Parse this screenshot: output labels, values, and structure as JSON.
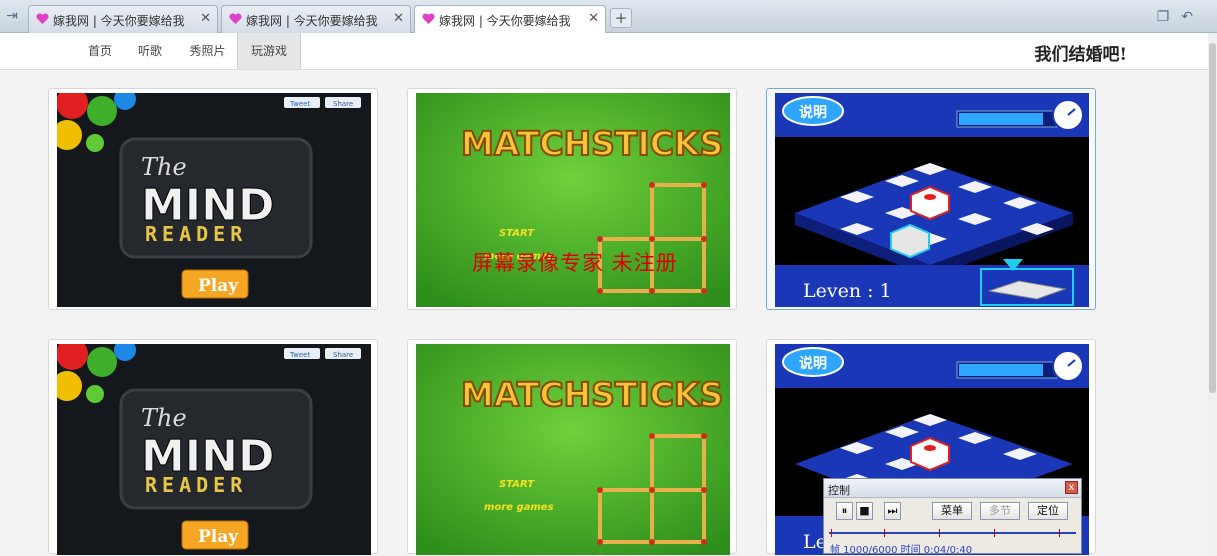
{
  "browser": {
    "tabs": [
      {
        "title": "嫁我网 | 今天你要嫁给我",
        "active": false
      },
      {
        "title": "嫁我网 | 今天你要嫁给我",
        "active": false
      },
      {
        "title": "嫁我网 | 今天你要嫁给我",
        "active": true
      }
    ],
    "newtab_label": "+",
    "close_label": "✕"
  },
  "nav": {
    "items": [
      "首页",
      "听歌",
      "秀照片",
      "玩游戏"
    ],
    "active_index": 3,
    "slogan": "我们结婚吧!"
  },
  "games": {
    "mind_reader": {
      "title_the": "The",
      "title_mind": "MIND",
      "title_reader": "READER",
      "play": "Play",
      "tweet": "Tweet",
      "share": "Share"
    },
    "matchsticks": {
      "title": "MATCHSTICKS",
      "start": "START",
      "more": "more games"
    },
    "puzzle": {
      "help": "说明",
      "level": "Leven : 1",
      "level_short": "Le"
    }
  },
  "watermark": "屏幕录像专家  未注册",
  "control_window": {
    "title": "控制",
    "close": "x",
    "btn_menu": "菜单",
    "btn_section": "多节",
    "btn_locate": "定位",
    "status": "帧 1000/6000 时间 0:04/0:40"
  },
  "colors": {
    "puzzle_blue": "#1a37b8",
    "matchsticks_green": "#45b22a",
    "watermark_red": "#e00000",
    "pink_heart": "#e040c8"
  }
}
